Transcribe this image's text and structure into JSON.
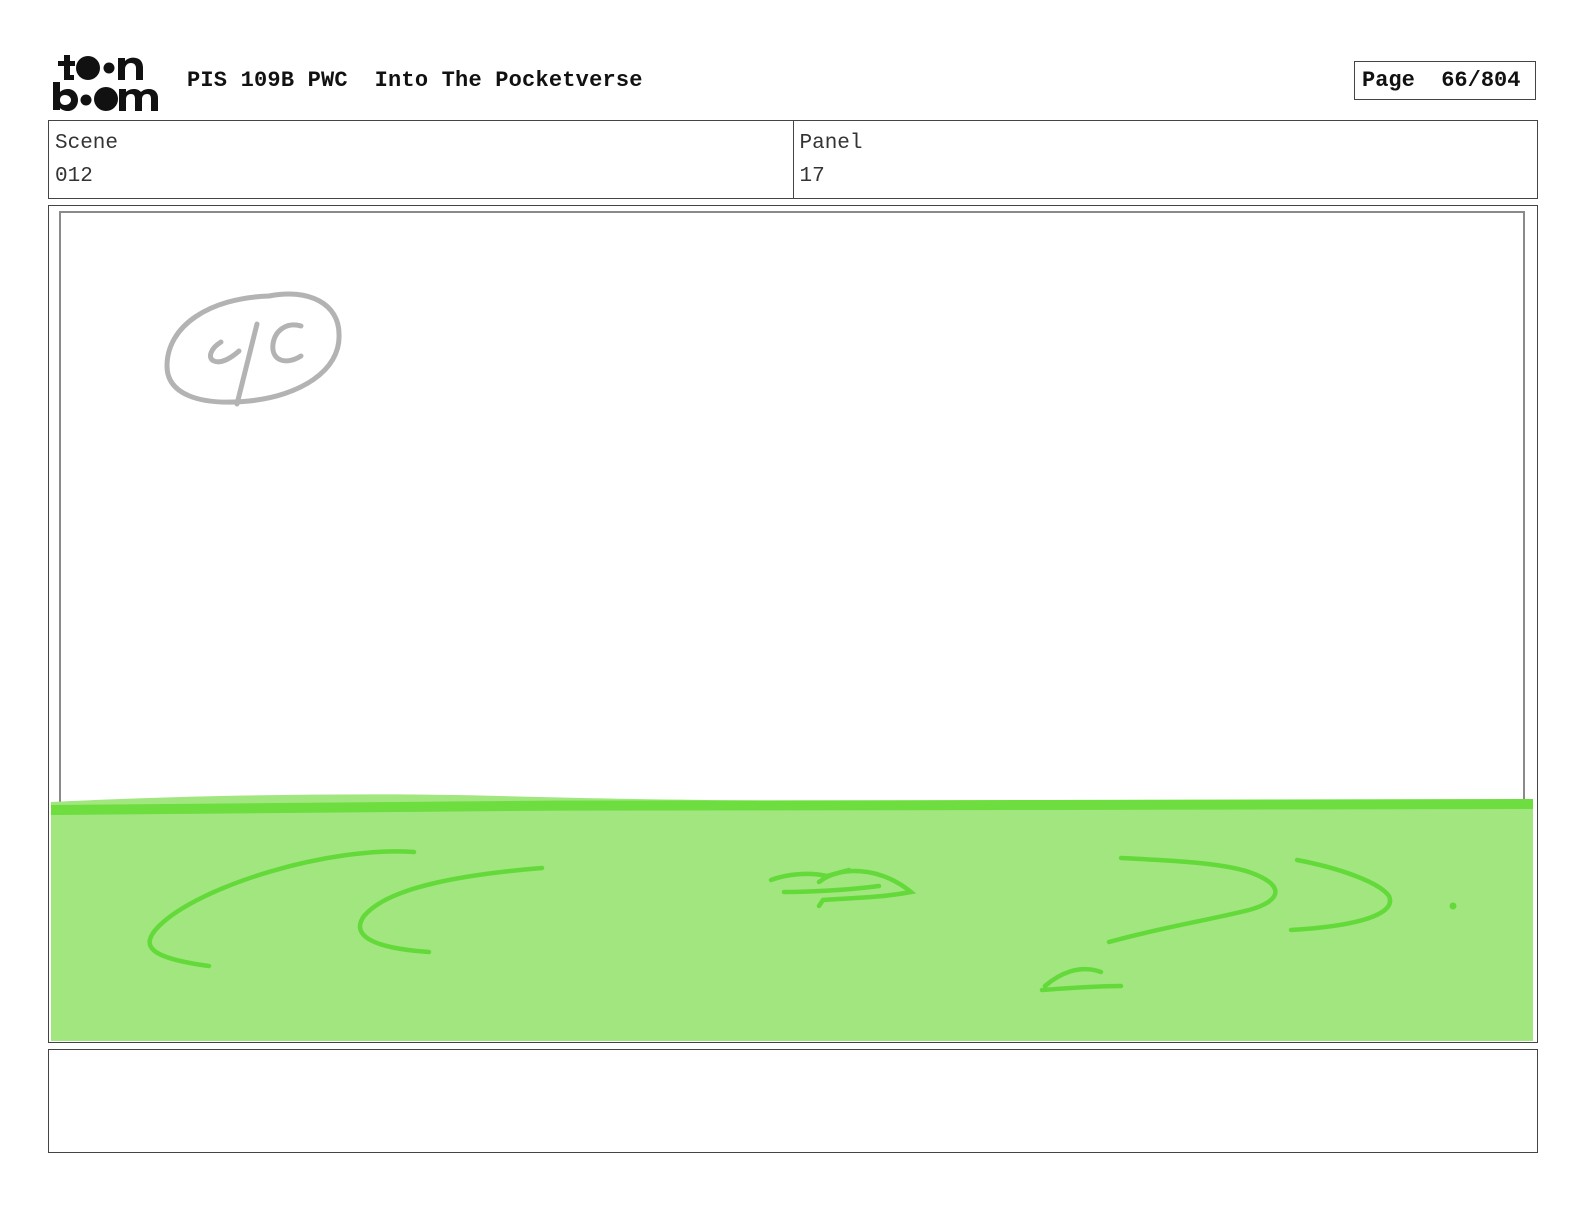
{
  "header": {
    "logo_text_top": "t●●n",
    "logo_text_bottom": "b●●m",
    "title": "PIS 109B PWC  Into The Pocketverse",
    "page_label": "Page",
    "page_value": "66/804"
  },
  "info": {
    "scene_label": "Scene",
    "scene_value": "012",
    "panel_label": "Panel",
    "panel_value": "17"
  },
  "drawing": {
    "sketch_note": "c/c",
    "ground_fill_color": "#a1e67f",
    "ground_line_color": "#6ddd3f",
    "sketch_color": "#b3b3b3",
    "ground_stroke_color": "#63d93a"
  },
  "notes": {
    "text": ""
  }
}
